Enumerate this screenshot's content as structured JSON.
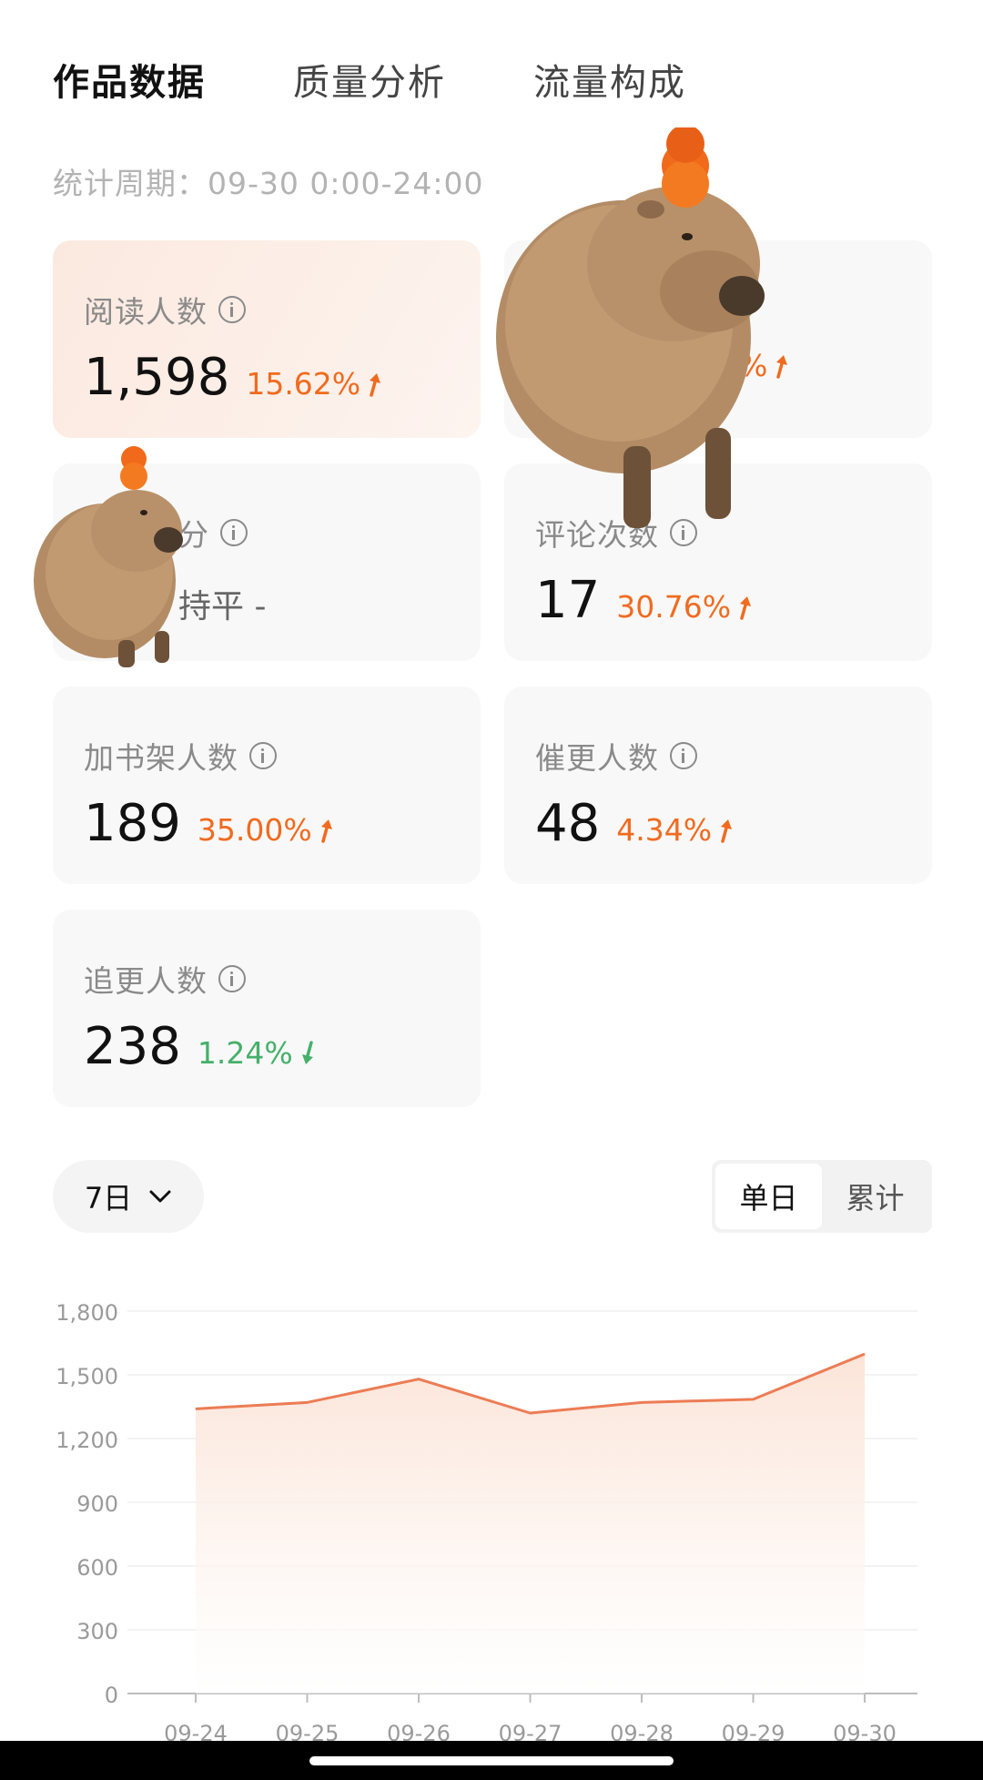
{
  "tabs": [
    {
      "label": "作品数据",
      "active": true
    },
    {
      "label": "质量分析",
      "active": false
    },
    {
      "label": "流量构成",
      "active": false
    }
  ],
  "period": "统计周期：09-30 0:00-24:00",
  "metrics": {
    "read": {
      "label": "阅读人数",
      "value": "1,598",
      "change": "15.62%",
      "trend": "up"
    },
    "top_right": {
      "label": "",
      "value": "",
      "change": "%",
      "trend": "up"
    },
    "score": {
      "label": "分",
      "value": "",
      "change": "持平 -",
      "trend": "flat"
    },
    "comments": {
      "label": "评论次数",
      "value": "17",
      "change": "30.76%",
      "trend": "up"
    },
    "shelf": {
      "label": "加书架人数",
      "value": "189",
      "change": "35.00%",
      "trend": "up"
    },
    "urge": {
      "label": "催更人数",
      "value": "48",
      "change": "4.34%",
      "trend": "up"
    },
    "follow": {
      "label": "追更人数",
      "value": "238",
      "change": "1.24%",
      "trend": "down"
    }
  },
  "controls": {
    "range_label": "7日",
    "mode_options": [
      "单日",
      "累计"
    ],
    "mode_active": "单日"
  },
  "colors": {
    "accent": "#f06b1f",
    "down": "#46b06a",
    "line": "#ec7c55"
  },
  "chart_data": {
    "type": "area",
    "x": [
      "09-24",
      "09-25",
      "09-26",
      "09-27",
      "09-28",
      "09-29",
      "09-30"
    ],
    "series": [
      {
        "values": [
          1340,
          1370,
          1480,
          1320,
          1370,
          1385,
          1598
        ]
      }
    ],
    "yticks": [
      "0",
      "300",
      "600",
      "900",
      "1,200",
      "1,500",
      "1,800"
    ],
    "ylim": [
      0,
      1800
    ],
    "grid": true
  }
}
